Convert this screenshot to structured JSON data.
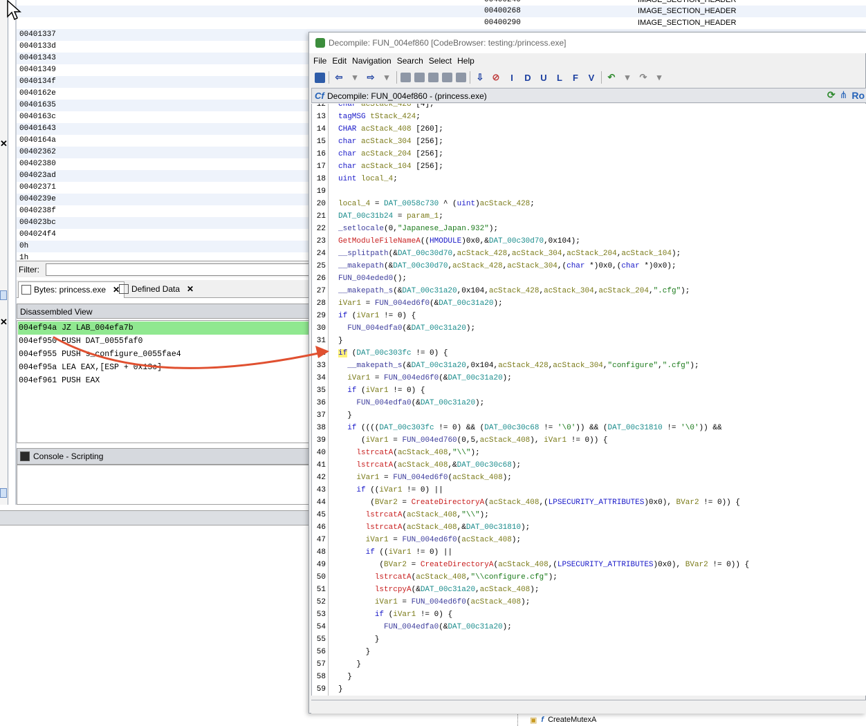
{
  "background_table": {
    "top_rows": [
      {
        "address": "00400268",
        "type": "IMAGE_SECTION_HEADER"
      },
      {
        "address": "00400290",
        "type": "IMAGE_SECTION_HEADER"
      }
    ],
    "rows": [
      "00401337",
      "0040133d",
      "00401343",
      "00401349",
      "0040134f",
      "0040162e",
      "00401635",
      "0040163c",
      "00401643",
      "0040164a",
      "00402362",
      "00402380",
      "004023ad",
      "00402371",
      "0040239e",
      "0040238f",
      "004023bc",
      "004024f4",
      "0h",
      "1h"
    ]
  },
  "filter": {
    "label": "Filter:",
    "value": ""
  },
  "tabs": [
    {
      "label": "Bytes: princess.exe",
      "close": "✕"
    },
    {
      "label": "Defined Data",
      "close": "✕",
      "icon_text": "0101 DAT"
    }
  ],
  "disassembled_view": {
    "title": "Disassembled View",
    "lines": [
      "004ef94a JZ LAB_004efa7b",
      "004ef950 PUSH DAT_0055faf0",
      "004ef955 PUSH s_configure_0055fae4",
      "004ef95a LEA EAX,[ESP + 0x13c]",
      "004ef961 PUSH EAX"
    ]
  },
  "console": {
    "title": "Console - Scripting"
  },
  "tree_item": {
    "label": "CreateMutexA"
  },
  "decompile_window": {
    "title": "Decompile: FUN_004ef860 [CodeBrowser: testing:/princess.exe]",
    "menu": [
      "File",
      "Edit",
      "Navigation",
      "Search",
      "Select",
      "Help"
    ],
    "toolbar_letters": [
      "I",
      "D",
      "U",
      "L",
      "F",
      "V"
    ],
    "panel_title": "Decompile: FUN_004ef860 - (princess.exe)",
    "panel_right_text": "Ro",
    "code_lines": [
      {
        "n": "12",
        "t": "char acStack_428 [4];"
      },
      {
        "n": "13",
        "t": "tagMSG tStack_424;"
      },
      {
        "n": "14",
        "t": "CHAR acStack_408 [260];"
      },
      {
        "n": "15",
        "t": "char acStack_304 [256];"
      },
      {
        "n": "16",
        "t": "char acStack_204 [256];"
      },
      {
        "n": "17",
        "t": "char acStack_104 [256];"
      },
      {
        "n": "18",
        "t": "uint local_4;"
      },
      {
        "n": "19",
        "t": ""
      },
      {
        "n": "20",
        "t": "local_4 = DAT_0058c730 ^ (uint)acStack_428;"
      },
      {
        "n": "21",
        "t": "DAT_00c31b24 = param_1;"
      },
      {
        "n": "22",
        "t": "_setlocale(0,\"Japanese_Japan.932\");"
      },
      {
        "n": "23",
        "t": "GetModuleFileNameA((HMODULE)0x0,&DAT_00c30d70,0x104);"
      },
      {
        "n": "24",
        "t": "__splitpath(&DAT_00c30d70,acStack_428,acStack_304,acStack_204,acStack_104);"
      },
      {
        "n": "25",
        "t": "__makepath(&DAT_00c30d70,acStack_428,acStack_304,(char *)0x0,(char *)0x0);"
      },
      {
        "n": "26",
        "t": "FUN_004eded0();"
      },
      {
        "n": "27",
        "t": "__makepath_s(&DAT_00c31a20,0x104,acStack_428,acStack_304,acStack_204,\".cfg\");"
      },
      {
        "n": "28",
        "t": "iVar1 = FUN_004ed6f0(&DAT_00c31a20);"
      },
      {
        "n": "29",
        "t": "if (iVar1 != 0) {"
      },
      {
        "n": "30",
        "t": "  FUN_004edfa0(&DAT_00c31a20);"
      },
      {
        "n": "31",
        "t": "}"
      },
      {
        "n": "32",
        "t": "if (DAT_00c303fc != 0) {"
      },
      {
        "n": "33",
        "t": "  __makepath_s(&DAT_00c31a20,0x104,acStack_428,acStack_304,\"configure\",\".cfg\");"
      },
      {
        "n": "34",
        "t": "  iVar1 = FUN_004ed6f0(&DAT_00c31a20);"
      },
      {
        "n": "35",
        "t": "  if (iVar1 != 0) {"
      },
      {
        "n": "36",
        "t": "    FUN_004edfa0(&DAT_00c31a20);"
      },
      {
        "n": "37",
        "t": "  }"
      },
      {
        "n": "38",
        "t": "  if ((((DAT_00c303fc != 0) && (DAT_00c30c68 != '\\0')) && (DAT_00c31810 != '\\0')) &&"
      },
      {
        "n": "39",
        "t": "     (iVar1 = FUN_004ed760(0,5,acStack_408), iVar1 != 0)) {"
      },
      {
        "n": "40",
        "t": "    lstrcatA(acStack_408,\"\\\\\");"
      },
      {
        "n": "41",
        "t": "    lstrcatA(acStack_408,&DAT_00c30c68);"
      },
      {
        "n": "42",
        "t": "    iVar1 = FUN_004ed6f0(acStack_408);"
      },
      {
        "n": "43",
        "t": "    if ((iVar1 != 0) ||"
      },
      {
        "n": "44",
        "t": "       (BVar2 = CreateDirectoryA(acStack_408,(LPSECURITY_ATTRIBUTES)0x0), BVar2 != 0)) {"
      },
      {
        "n": "45",
        "t": "      lstrcatA(acStack_408,\"\\\\\");"
      },
      {
        "n": "46",
        "t": "      lstrcatA(acStack_408,&DAT_00c31810);"
      },
      {
        "n": "47",
        "t": "      iVar1 = FUN_004ed6f0(acStack_408);"
      },
      {
        "n": "48",
        "t": "      if ((iVar1 != 0) ||"
      },
      {
        "n": "49",
        "t": "         (BVar2 = CreateDirectoryA(acStack_408,(LPSECURITY_ATTRIBUTES)0x0), BVar2 != 0)) {"
      },
      {
        "n": "50",
        "t": "        lstrcatA(acStack_408,\"\\\\configure.cfg\");"
      },
      {
        "n": "51",
        "t": "        lstrcpyA(&DAT_00c31a20,acStack_408);"
      },
      {
        "n": "52",
        "t": "        iVar1 = FUN_004ed6f0(acStack_408);"
      },
      {
        "n": "53",
        "t": "        if (iVar1 != 0) {"
      },
      {
        "n": "54",
        "t": "          FUN_004edfa0(&DAT_00c31a20);"
      },
      {
        "n": "55",
        "t": "        }"
      },
      {
        "n": "56",
        "t": "      }"
      },
      {
        "n": "57",
        "t": "    }"
      },
      {
        "n": "58",
        "t": "  }"
      },
      {
        "n": "59",
        "t": "}"
      }
    ]
  },
  "colors": {
    "highlight_row": "#90e890",
    "arrow": "#e05030",
    "keyword": "#1818c8"
  }
}
